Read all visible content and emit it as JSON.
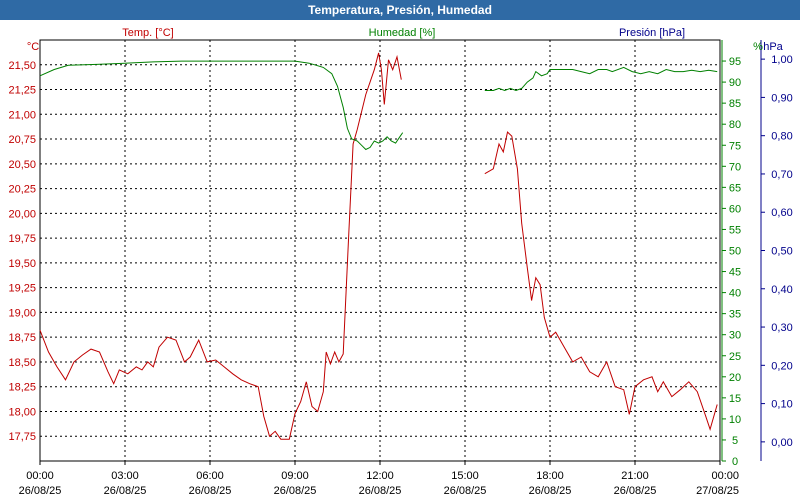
{
  "title": "Temperatura, Presión, Humedad",
  "chart_data": {
    "type": "line",
    "title": "Temperatura, Presión, Humedad",
    "legend": {
      "temp": "Temp. [°C]",
      "hum": "Humedad [%]",
      "pres": "Presión [hPa]"
    },
    "units": {
      "temp": "°C",
      "hum": "%",
      "pres": "hPa"
    },
    "colors": {
      "temp": "#c00000",
      "hum": "#008000",
      "pres": "#00008b",
      "grid": "#000000",
      "title_bg": "#2f6aa5"
    },
    "grid": true,
    "axes": {
      "temp": {
        "min": 17.5,
        "max": 21.75,
        "ticks": [
          "17,75",
          "18,00",
          "18,25",
          "18,50",
          "18,75",
          "19,00",
          "19,25",
          "19,50",
          "19,75",
          "20,00",
          "20,25",
          "20,50",
          "20,75",
          "21,00",
          "21,25",
          "21,50"
        ],
        "tick_values": [
          17.75,
          18.0,
          18.25,
          18.5,
          18.75,
          19.0,
          19.25,
          19.5,
          19.75,
          20.0,
          20.25,
          20.5,
          20.75,
          21.0,
          21.25,
          21.5
        ]
      },
      "hum": {
        "min": 0,
        "max": 100,
        "ticks": [
          "0",
          "5",
          "10",
          "15",
          "20",
          "25",
          "30",
          "35",
          "40",
          "45",
          "50",
          "55",
          "60",
          "65",
          "70",
          "75",
          "80",
          "85",
          "90",
          "95"
        ],
        "tick_values": [
          0,
          5,
          10,
          15,
          20,
          25,
          30,
          35,
          40,
          45,
          50,
          55,
          60,
          65,
          70,
          75,
          80,
          85,
          90,
          95
        ]
      },
      "pres": {
        "min": -0.05,
        "max": 1.05,
        "ticks": [
          "0,00",
          "0,10",
          "0,20",
          "0,30",
          "0,40",
          "0,50",
          "0,60",
          "0,70",
          "0,80",
          "0,90",
          "1,00"
        ],
        "tick_values": [
          0,
          0.1,
          0.2,
          0.3,
          0.4,
          0.5,
          0.6,
          0.7,
          0.8,
          0.9,
          1.0
        ]
      },
      "x": {
        "min": 0,
        "max": 24,
        "ticks": [
          {
            "time": "00:00",
            "date": "26/08/25"
          },
          {
            "time": "03:00",
            "date": "26/08/25"
          },
          {
            "time": "06:00",
            "date": "26/08/25"
          },
          {
            "time": "09:00",
            "date": "26/08/25"
          },
          {
            "time": "12:00",
            "date": "26/08/25"
          },
          {
            "time": "15:00",
            "date": "26/08/25"
          },
          {
            "time": "18:00",
            "date": "26/08/25"
          },
          {
            "time": "21:00",
            "date": "26/08/25"
          },
          {
            "time": "00:00",
            "date": "27/08/25"
          }
        ],
        "tick_values": [
          0,
          3,
          6,
          9,
          12,
          15,
          18,
          21,
          24
        ]
      }
    },
    "series": [
      {
        "name": "Temp. [°C]",
        "axis": "temp",
        "segments": [
          [
            [
              0,
              18.82
            ],
            [
              0.3,
              18.6
            ],
            [
              0.6,
              18.45
            ],
            [
              0.9,
              18.32
            ],
            [
              1.2,
              18.5
            ],
            [
              1.5,
              18.57
            ],
            [
              1.8,
              18.63
            ],
            [
              2.1,
              18.6
            ],
            [
              2.4,
              18.4
            ],
            [
              2.6,
              18.28
            ],
            [
              2.8,
              18.42
            ],
            [
              3.1,
              18.38
            ],
            [
              3.4,
              18.45
            ],
            [
              3.6,
              18.42
            ],
            [
              3.8,
              18.5
            ],
            [
              4.0,
              18.45
            ],
            [
              4.2,
              18.65
            ],
            [
              4.5,
              18.75
            ],
            [
              4.8,
              18.72
            ],
            [
              5.1,
              18.5
            ],
            [
              5.3,
              18.55
            ],
            [
              5.6,
              18.72
            ],
            [
              5.9,
              18.5
            ],
            [
              6.2,
              18.52
            ],
            [
              6.5,
              18.45
            ],
            [
              6.8,
              18.38
            ],
            [
              7.1,
              18.32
            ],
            [
              7.4,
              18.28
            ],
            [
              7.7,
              18.25
            ],
            [
              7.9,
              17.95
            ],
            [
              8.1,
              17.75
            ],
            [
              8.3,
              17.8
            ],
            [
              8.5,
              17.72
            ],
            [
              8.8,
              17.72
            ],
            [
              9.0,
              17.98
            ],
            [
              9.2,
              18.1
            ],
            [
              9.4,
              18.3
            ],
            [
              9.6,
              18.05
            ],
            [
              9.8,
              18.0
            ],
            [
              10.0,
              18.2
            ],
            [
              10.1,
              18.6
            ],
            [
              10.25,
              18.48
            ],
            [
              10.4,
              18.6
            ],
            [
              10.55,
              18.5
            ],
            [
              10.7,
              18.58
            ],
            [
              10.9,
              19.8
            ],
            [
              11.05,
              20.7
            ],
            [
              11.2,
              20.85
            ],
            [
              11.5,
              21.2
            ],
            [
              11.8,
              21.45
            ],
            [
              11.95,
              21.62
            ],
            [
              12.05,
              21.45
            ],
            [
              12.15,
              21.1
            ],
            [
              12.3,
              21.55
            ],
            [
              12.45,
              21.45
            ],
            [
              12.6,
              21.58
            ],
            [
              12.75,
              21.35
            ]
          ],
          [
            [
              15.7,
              20.4
            ],
            [
              16.0,
              20.45
            ],
            [
              16.2,
              20.7
            ],
            [
              16.35,
              20.62
            ],
            [
              16.5,
              20.82
            ],
            [
              16.65,
              20.78
            ],
            [
              16.85,
              20.45
            ],
            [
              17.0,
              19.9
            ],
            [
              17.2,
              19.45
            ],
            [
              17.35,
              19.12
            ],
            [
              17.5,
              19.35
            ],
            [
              17.65,
              19.28
            ],
            [
              17.8,
              18.95
            ],
            [
              18.0,
              18.75
            ],
            [
              18.2,
              18.8
            ],
            [
              18.5,
              18.65
            ],
            [
              18.8,
              18.5
            ],
            [
              19.1,
              18.55
            ],
            [
              19.4,
              18.4
            ],
            [
              19.7,
              18.35
            ],
            [
              20.0,
              18.5
            ],
            [
              20.3,
              18.25
            ],
            [
              20.6,
              18.22
            ],
            [
              20.8,
              17.97
            ],
            [
              21.0,
              18.25
            ],
            [
              21.3,
              18.32
            ],
            [
              21.6,
              18.35
            ],
            [
              21.8,
              18.2
            ],
            [
              22.0,
              18.3
            ],
            [
              22.3,
              18.15
            ],
            [
              22.6,
              18.22
            ],
            [
              22.9,
              18.3
            ],
            [
              23.2,
              18.2
            ],
            [
              23.5,
              17.95
            ],
            [
              23.65,
              17.82
            ],
            [
              23.9,
              18.07
            ]
          ]
        ]
      },
      {
        "name": "Humedad [%]",
        "axis": "hum",
        "segments": [
          [
            [
              0,
              91.5
            ],
            [
              0.5,
              93
            ],
            [
              1.0,
              94
            ],
            [
              2.0,
              94.2
            ],
            [
              3.0,
              94.5
            ],
            [
              4.0,
              94.8
            ],
            [
              5.0,
              95
            ],
            [
              6.0,
              95
            ],
            [
              7.0,
              95
            ],
            [
              8.0,
              95
            ],
            [
              9.0,
              95
            ],
            [
              9.5,
              94.5
            ],
            [
              10.0,
              93.5
            ],
            [
              10.3,
              92
            ],
            [
              10.5,
              89
            ],
            [
              10.7,
              84
            ],
            [
              10.85,
              79
            ],
            [
              11.0,
              76.5
            ],
            [
              11.2,
              76
            ],
            [
              11.35,
              75
            ],
            [
              11.5,
              74
            ],
            [
              11.65,
              74.5
            ],
            [
              11.8,
              76
            ],
            [
              11.95,
              75.5
            ],
            [
              12.1,
              76
            ],
            [
              12.25,
              77
            ],
            [
              12.4,
              76
            ],
            [
              12.55,
              75.5
            ],
            [
              12.7,
              77
            ],
            [
              12.8,
              78
            ]
          ],
          [
            [
              15.7,
              88
            ],
            [
              16.0,
              88
            ],
            [
              16.2,
              88.5
            ],
            [
              16.4,
              88
            ],
            [
              16.6,
              88.5
            ],
            [
              16.8,
              88
            ],
            [
              17.0,
              88.5
            ],
            [
              17.2,
              90
            ],
            [
              17.4,
              91
            ],
            [
              17.5,
              92.5
            ],
            [
              17.7,
              91.5
            ],
            [
              17.9,
              92
            ],
            [
              18.0,
              93
            ],
            [
              18.2,
              93
            ],
            [
              18.5,
              93
            ],
            [
              18.8,
              93
            ],
            [
              19.1,
              92.5
            ],
            [
              19.4,
              92
            ],
            [
              19.7,
              93
            ],
            [
              20.0,
              93
            ],
            [
              20.2,
              92.5
            ],
            [
              20.6,
              93.5
            ],
            [
              20.9,
              92.5
            ],
            [
              21.2,
              92
            ],
            [
              21.5,
              92.5
            ],
            [
              21.8,
              92
            ],
            [
              22.1,
              93
            ],
            [
              22.4,
              92.5
            ],
            [
              22.7,
              92.5
            ],
            [
              23.0,
              92.8
            ],
            [
              23.3,
              92.5
            ],
            [
              23.6,
              92.8
            ],
            [
              23.9,
              92.5
            ]
          ]
        ]
      }
    ]
  }
}
